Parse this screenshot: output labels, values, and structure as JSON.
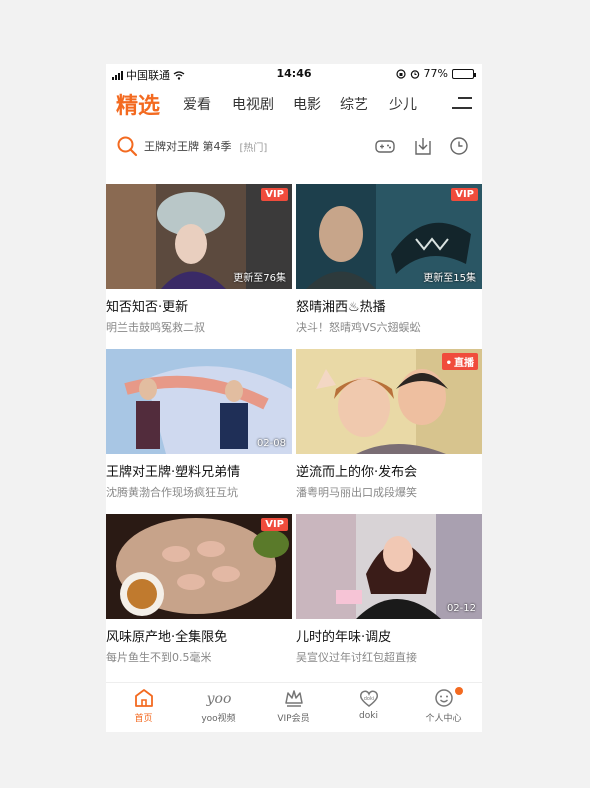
{
  "status_bar": {
    "carrier": "中国联通",
    "time": "14:46",
    "battery_text": "77%",
    "battery_level": 0.77
  },
  "nav": {
    "tabs": [
      "精选",
      "爱看",
      "电视剧",
      "电影",
      "综艺",
      "少儿"
    ],
    "active_index": 0,
    "accent_color": "#f36a20"
  },
  "search": {
    "query": "王牌对王牌 第4季",
    "tag": "[热门]"
  },
  "cards": [
    {
      "title": "知否知否·更新",
      "subtitle": "明兰击鼓鸣冤救二叔",
      "badge": "VIP",
      "overlay": "更新至76集"
    },
    {
      "title": "怒晴湘西♨热播",
      "subtitle": "决斗！怒晴鸡VS六翅蜈蚣",
      "badge": "VIP",
      "overlay": "更新至15集"
    },
    {
      "title": "王牌对王牌·塑料兄弟情",
      "subtitle": "沈腾黄渤合作现场疯狂互坑",
      "badge": "",
      "overlay": "02-08"
    },
    {
      "title": "逆流而上的你·发布会",
      "subtitle": "潘粤明马丽出口成段爆笑",
      "badge": "直播",
      "overlay": ""
    },
    {
      "title": "风味原产地·全集限免",
      "subtitle": "每片鱼生不到0.5毫米",
      "badge": "VIP",
      "overlay": ""
    },
    {
      "title": "儿时的年味·调皮",
      "subtitle": "吴宣仪过年讨红包超直接",
      "badge": "",
      "overlay": "02-12"
    }
  ],
  "bottom_tabs": [
    {
      "label": "首页",
      "icon": "home-icon"
    },
    {
      "label": "yoo视频",
      "icon": "yoo-icon",
      "glyph": "yoo"
    },
    {
      "label": "VIP会员",
      "icon": "vip-crown-icon"
    },
    {
      "label": "doki",
      "icon": "doki-heart-icon",
      "glyph": "doki"
    },
    {
      "label": "个人中心",
      "icon": "profile-face-icon"
    }
  ],
  "badge_color": "#f04c3c"
}
